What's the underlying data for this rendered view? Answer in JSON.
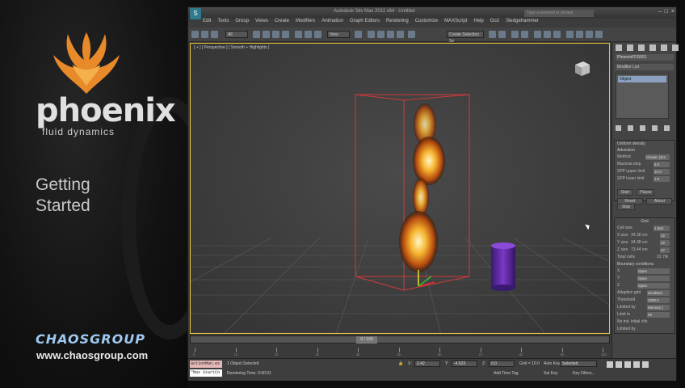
{
  "promo": {
    "brand_name": "phoenix",
    "brand_sub": "fluid dynamics",
    "heading": "Getting Started",
    "chaos_logo": "CHAOSGROUP",
    "chaos_url": "www.chaosgroup.com"
  },
  "app": {
    "title": "Autodesk 3ds Max 2011 x64",
    "title_file": "Untitled",
    "search_placeholder": "Type a keyword or phrase",
    "menus": [
      "Edit",
      "Tools",
      "Group",
      "Views",
      "Create",
      "Modifiers",
      "Animation",
      "Graph Editors",
      "Rendering",
      "Customize",
      "MAXScript",
      "Help",
      "Go2",
      "Sledgehammer"
    ],
    "toolbar": {
      "selection_filter": "All",
      "ref_coord": "View",
      "named_sel": "Create Selection Se"
    },
    "viewport_label": "[ + ] [ Perspective ] [ Smooth + Highlights ]",
    "cmdpanel": {
      "object_name": "PhoenixFDS001",
      "modifier_list": "Modifier List",
      "stack_item": "Object",
      "rollouts": {
        "about": "Uniform density",
        "advection_title": "Advection",
        "method_label": "Method",
        "method_value": "Classic (Sm",
        "max_step_label": "Maximal step",
        "max_step_value": "8.0",
        "spp_upper_label": "SPP upper limit",
        "spp_upper_value": "10.0",
        "spp_lower_label": "SPP lower limit",
        "spp_lower_value": "2.0",
        "start_label": "Start",
        "pause_label": "Pause",
        "stop_label": "Stop",
        "reset_label": "Reset",
        "about_label": "About",
        "grid_title": "Grid",
        "cell_size_label": "Cell size",
        "cell_size_value": "1.563",
        "xsize_label": "X size",
        "xsize_value": "34.38 cm",
        "xsize_cells": "22",
        "ysize_label": "Y size",
        "ysize_value": "34.38 cm",
        "ysize_cells": "22",
        "zsize_label": "Z size",
        "zsize_value": "73.44 cm",
        "zsize_cells": "47",
        "total_label": "Total cells",
        "total_value": "22.7M",
        "boundary_title": "Boundary conditions",
        "bx_label": "X",
        "bx_value": "Open",
        "by_label": "Y",
        "by_value": "Open",
        "bz_label": "Z",
        "bz_value": "Open",
        "adaptive_label": "Adaptive grid",
        "adaptive_value": "Disabled",
        "threshold_label": "Threshold",
        "threshold_value": "1000.0",
        "limited_by_label": "Limited by",
        "limited_by_value": "Memory (",
        "limit_to_label": "Limit to",
        "limit_to_value": "90",
        "no_init_label": "No init. initial chk",
        "cache_label": "Limited by"
      }
    },
    "timeline": {
      "slider": "0 / 100",
      "ticks": [
        "0",
        "10",
        "20",
        "30",
        "40",
        "50",
        "60",
        "70",
        "80",
        "90",
        "100"
      ]
    },
    "status": {
      "script_line1": "actionMan.ex",
      "script_line2": "\"Max StartCo",
      "selected": "1 Object Selected",
      "rendering_time": "Rendering Time: 0:00:01",
      "x_label": "X:",
      "x_value": "2.42",
      "y_label": "Y:",
      "y_value": "-4.523",
      "z_label": "Z:",
      "z_value": "0.0",
      "grid": "Grid = 10.0",
      "add_time_tag": "Add Time Tag",
      "auto_key": "Auto Key",
      "selected_dd": "Selected",
      "set_key": "Set Key",
      "key_filters": "Key Filters..."
    }
  }
}
